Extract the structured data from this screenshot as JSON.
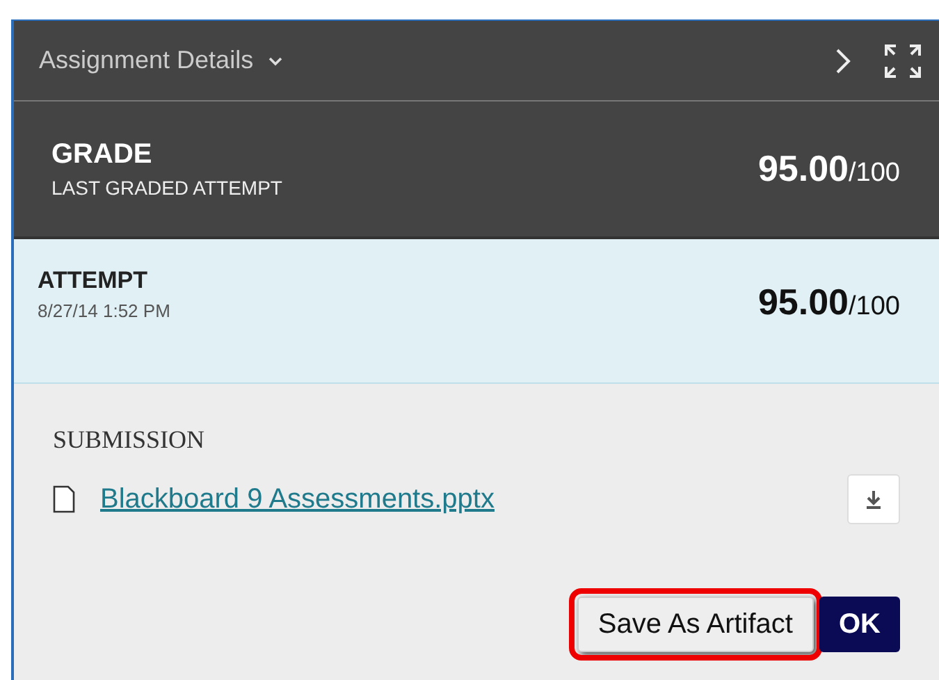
{
  "header": {
    "title": "Assignment Details"
  },
  "grade": {
    "label": "GRADE",
    "sublabel": "LAST GRADED ATTEMPT",
    "score": "**95.00**/100"
  },
  "attempt": {
    "label": "ATTEMPT",
    "date": "8/27/14 1:52 PM",
    "score": "**95.00**/100"
  },
  "submission": {
    "heading": "SUBMISSION",
    "file": "Blackboard 9 Assessments.pptx"
  },
  "buttons": [
    {
      "label": "Save As Artifact",
      "kind": "secondary",
      "highlighted": true
    },
    {
      "label": "OK",
      "kind": "primary",
      "highlighted": false
    }
  ]
}
